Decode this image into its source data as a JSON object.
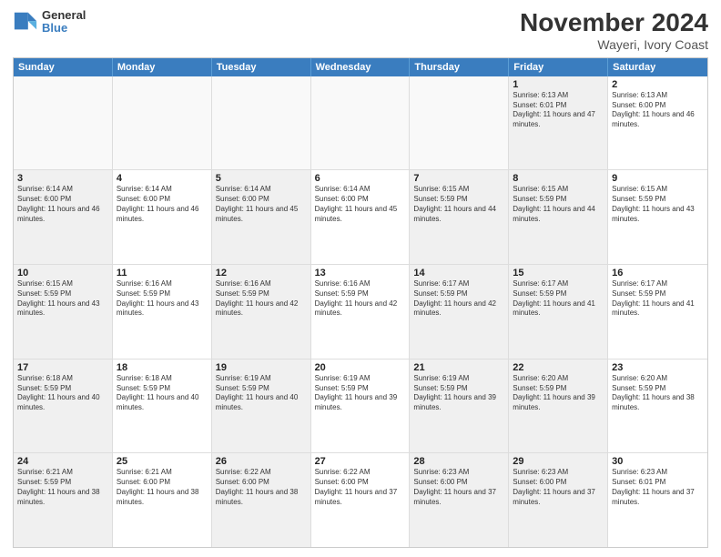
{
  "logo": {
    "line1": "General",
    "line2": "Blue"
  },
  "title": "November 2024",
  "subtitle": "Wayeri, Ivory Coast",
  "headers": [
    "Sunday",
    "Monday",
    "Tuesday",
    "Wednesday",
    "Thursday",
    "Friday",
    "Saturday"
  ],
  "rows": [
    [
      {
        "day": "",
        "text": "",
        "empty": true
      },
      {
        "day": "",
        "text": "",
        "empty": true
      },
      {
        "day": "",
        "text": "",
        "empty": true
      },
      {
        "day": "",
        "text": "",
        "empty": true
      },
      {
        "day": "",
        "text": "",
        "empty": true
      },
      {
        "day": "1",
        "text": "Sunrise: 6:13 AM\nSunset: 6:01 PM\nDaylight: 11 hours and 47 minutes.",
        "shaded": true
      },
      {
        "day": "2",
        "text": "Sunrise: 6:13 AM\nSunset: 6:00 PM\nDaylight: 11 hours and 46 minutes.",
        "shaded": false
      }
    ],
    [
      {
        "day": "3",
        "text": "Sunrise: 6:14 AM\nSunset: 6:00 PM\nDaylight: 11 hours and 46 minutes.",
        "shaded": true
      },
      {
        "day": "4",
        "text": "Sunrise: 6:14 AM\nSunset: 6:00 PM\nDaylight: 11 hours and 46 minutes.",
        "shaded": false
      },
      {
        "day": "5",
        "text": "Sunrise: 6:14 AM\nSunset: 6:00 PM\nDaylight: 11 hours and 45 minutes.",
        "shaded": true
      },
      {
        "day": "6",
        "text": "Sunrise: 6:14 AM\nSunset: 6:00 PM\nDaylight: 11 hours and 45 minutes.",
        "shaded": false
      },
      {
        "day": "7",
        "text": "Sunrise: 6:15 AM\nSunset: 5:59 PM\nDaylight: 11 hours and 44 minutes.",
        "shaded": true
      },
      {
        "day": "8",
        "text": "Sunrise: 6:15 AM\nSunset: 5:59 PM\nDaylight: 11 hours and 44 minutes.",
        "shaded": true
      },
      {
        "day": "9",
        "text": "Sunrise: 6:15 AM\nSunset: 5:59 PM\nDaylight: 11 hours and 43 minutes.",
        "shaded": false
      }
    ],
    [
      {
        "day": "10",
        "text": "Sunrise: 6:15 AM\nSunset: 5:59 PM\nDaylight: 11 hours and 43 minutes.",
        "shaded": true
      },
      {
        "day": "11",
        "text": "Sunrise: 6:16 AM\nSunset: 5:59 PM\nDaylight: 11 hours and 43 minutes.",
        "shaded": false
      },
      {
        "day": "12",
        "text": "Sunrise: 6:16 AM\nSunset: 5:59 PM\nDaylight: 11 hours and 42 minutes.",
        "shaded": true
      },
      {
        "day": "13",
        "text": "Sunrise: 6:16 AM\nSunset: 5:59 PM\nDaylight: 11 hours and 42 minutes.",
        "shaded": false
      },
      {
        "day": "14",
        "text": "Sunrise: 6:17 AM\nSunset: 5:59 PM\nDaylight: 11 hours and 42 minutes.",
        "shaded": true
      },
      {
        "day": "15",
        "text": "Sunrise: 6:17 AM\nSunset: 5:59 PM\nDaylight: 11 hours and 41 minutes.",
        "shaded": true
      },
      {
        "day": "16",
        "text": "Sunrise: 6:17 AM\nSunset: 5:59 PM\nDaylight: 11 hours and 41 minutes.",
        "shaded": false
      }
    ],
    [
      {
        "day": "17",
        "text": "Sunrise: 6:18 AM\nSunset: 5:59 PM\nDaylight: 11 hours and 40 minutes.",
        "shaded": true
      },
      {
        "day": "18",
        "text": "Sunrise: 6:18 AM\nSunset: 5:59 PM\nDaylight: 11 hours and 40 minutes.",
        "shaded": false
      },
      {
        "day": "19",
        "text": "Sunrise: 6:19 AM\nSunset: 5:59 PM\nDaylight: 11 hours and 40 minutes.",
        "shaded": true
      },
      {
        "day": "20",
        "text": "Sunrise: 6:19 AM\nSunset: 5:59 PM\nDaylight: 11 hours and 39 minutes.",
        "shaded": false
      },
      {
        "day": "21",
        "text": "Sunrise: 6:19 AM\nSunset: 5:59 PM\nDaylight: 11 hours and 39 minutes.",
        "shaded": true
      },
      {
        "day": "22",
        "text": "Sunrise: 6:20 AM\nSunset: 5:59 PM\nDaylight: 11 hours and 39 minutes.",
        "shaded": true
      },
      {
        "day": "23",
        "text": "Sunrise: 6:20 AM\nSunset: 5:59 PM\nDaylight: 11 hours and 38 minutes.",
        "shaded": false
      }
    ],
    [
      {
        "day": "24",
        "text": "Sunrise: 6:21 AM\nSunset: 5:59 PM\nDaylight: 11 hours and 38 minutes.",
        "shaded": true
      },
      {
        "day": "25",
        "text": "Sunrise: 6:21 AM\nSunset: 6:00 PM\nDaylight: 11 hours and 38 minutes.",
        "shaded": false
      },
      {
        "day": "26",
        "text": "Sunrise: 6:22 AM\nSunset: 6:00 PM\nDaylight: 11 hours and 38 minutes.",
        "shaded": true
      },
      {
        "day": "27",
        "text": "Sunrise: 6:22 AM\nSunset: 6:00 PM\nDaylight: 11 hours and 37 minutes.",
        "shaded": false
      },
      {
        "day": "28",
        "text": "Sunrise: 6:23 AM\nSunset: 6:00 PM\nDaylight: 11 hours and 37 minutes.",
        "shaded": true
      },
      {
        "day": "29",
        "text": "Sunrise: 6:23 AM\nSunset: 6:00 PM\nDaylight: 11 hours and 37 minutes.",
        "shaded": true
      },
      {
        "day": "30",
        "text": "Sunrise: 6:23 AM\nSunset: 6:01 PM\nDaylight: 11 hours and 37 minutes.",
        "shaded": false
      }
    ]
  ]
}
